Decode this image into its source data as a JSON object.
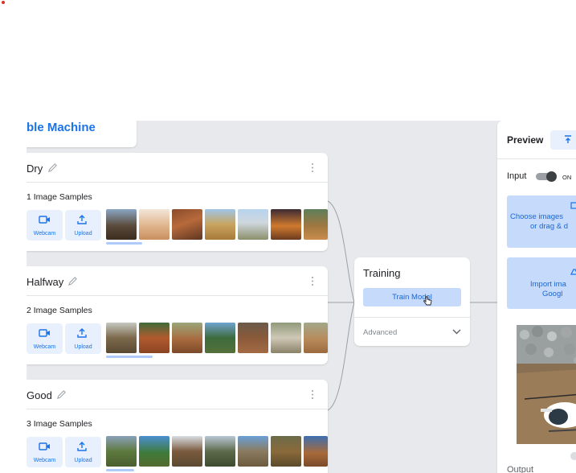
{
  "app": {
    "title_visible": "ble Machine"
  },
  "classes": [
    {
      "name": "Dry",
      "samples": "1 Image Samples",
      "samples_prefix_glyph": "1"
    },
    {
      "name": "Halfway",
      "samples": "2 Image Samples"
    },
    {
      "name": "Good",
      "samples": "3 Image Samples"
    }
  ],
  "class_buttons": {
    "webcam_label": "Webcam",
    "upload_label": "Upload"
  },
  "training": {
    "title": "Training",
    "train_button": "Train Model",
    "advanced_label": "Advanced"
  },
  "preview": {
    "title": "Preview",
    "input_label": "Input",
    "toggle_state": "ON",
    "upload_line1": "Choose images",
    "upload_line2": "or drag & d",
    "drive_line1": "Import ima",
    "drive_line2": "Googl",
    "output_label": "Output"
  },
  "colors": {
    "accent": "#1a73e8",
    "button_bg": "#e8f0fe",
    "train_btn_bg": "#c6dafc",
    "canvas_bg": "#e8e9ec"
  },
  "icons": {
    "webcam": "webcam-icon",
    "upload": "upload-icon",
    "pencil": "pencil-icon",
    "kebab": "more-vert-icon",
    "chevron": "chevron-down-icon",
    "export": "export-icon"
  }
}
